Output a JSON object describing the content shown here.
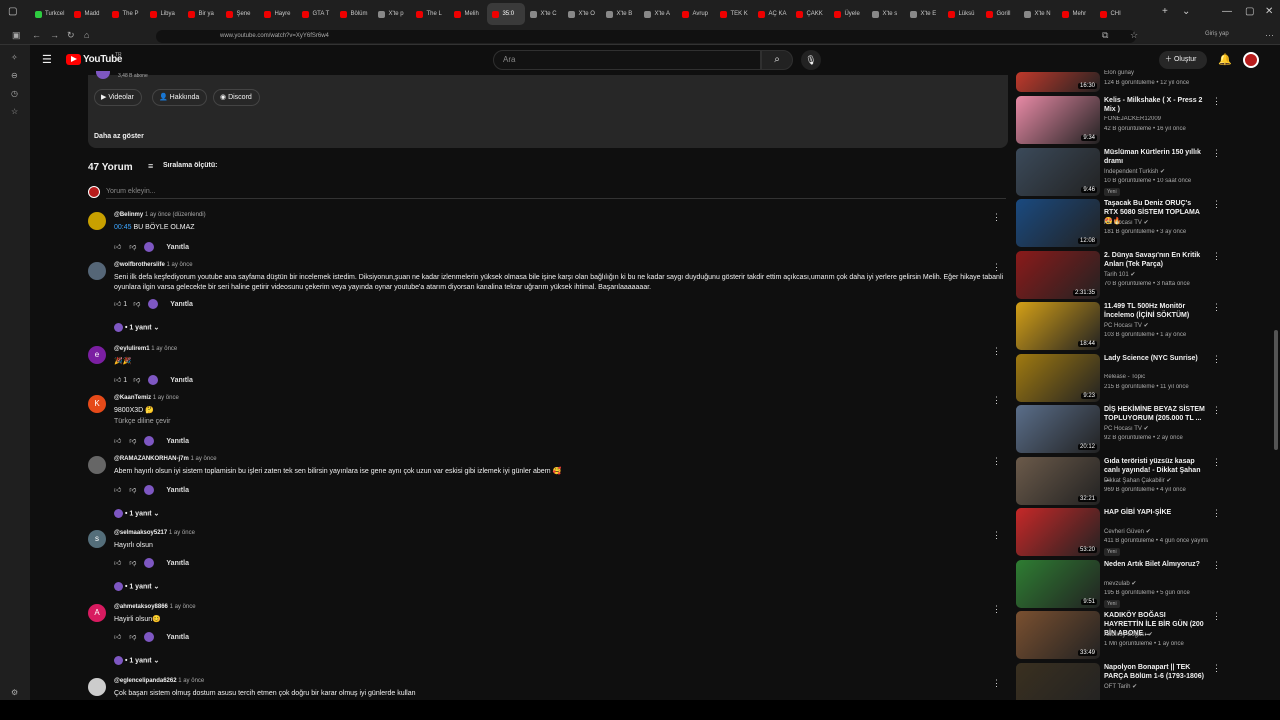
{
  "tabs": [
    {
      "label": "Turkcel",
      "color": "#2ecc40"
    },
    {
      "label": "Madd",
      "color": "#e00"
    },
    {
      "label": "The P",
      "color": "#e00"
    },
    {
      "label": "Libya",
      "color": "#e00"
    },
    {
      "label": "Bir ya",
      "color": "#e00"
    },
    {
      "label": "Şene",
      "color": "#e00"
    },
    {
      "label": "Hayre",
      "color": "#e00"
    },
    {
      "label": "GTA T",
      "color": "#e00"
    },
    {
      "label": "Bölüm",
      "color": "#e00"
    },
    {
      "label": "X'te p",
      "color": "#888"
    },
    {
      "label": "The L",
      "color": "#e00"
    },
    {
      "label": "Melih",
      "color": "#e00"
    },
    {
      "label": "35:0",
      "color": "#e00",
      "active": true
    },
    {
      "label": "X'te C",
      "color": "#888"
    },
    {
      "label": "X'te O",
      "color": "#888"
    },
    {
      "label": "X'te B",
      "color": "#888"
    },
    {
      "label": "X'te A",
      "color": "#888"
    },
    {
      "label": "Avrup",
      "color": "#e00"
    },
    {
      "label": "TEK K",
      "color": "#e00"
    },
    {
      "label": "AÇ KA",
      "color": "#e00"
    },
    {
      "label": "ÇAKK",
      "color": "#e00"
    },
    {
      "label": "Üyele",
      "color": "#e00"
    },
    {
      "label": "X'te s",
      "color": "#888"
    },
    {
      "label": "X'te E",
      "color": "#888"
    },
    {
      "label": "Lüksü",
      "color": "#e00"
    },
    {
      "label": "Gorill",
      "color": "#e00"
    },
    {
      "label": "X'te N",
      "color": "#888"
    },
    {
      "label": "Mehr",
      "color": "#e00"
    },
    {
      "label": "CHI",
      "color": "#e00"
    }
  ],
  "browser": {
    "url": "www.youtube.com/watch?v=XyY6fSr6w4",
    "signin": "Giriş yap"
  },
  "yt": {
    "logo": "YouTube",
    "region": "TR",
    "search_placeholder": "Ara",
    "create": "Oluştur"
  },
  "channel": {
    "subs": "3,48 B abone",
    "links": [
      "Videolar",
      "Hakkında",
      "Discord"
    ],
    "show_less": "Daha az göster"
  },
  "comments_header": {
    "count": "47 Yorum",
    "sort": "Sıralama ölçütü:",
    "add_placeholder": "Yorum ekleyin..."
  },
  "reply_label": "Yanıtla",
  "comments": [
    {
      "user": "@Belinmy",
      "time": "1 ay önce (düzenlendi)",
      "ts": "00:45",
      "text": " BU BÖYLE OLMAZ",
      "likes": "",
      "avatar": "#c8a000",
      "initial": "",
      "replies": ""
    },
    {
      "user": "@wolfbrotherslife",
      "time": "1 ay önce",
      "ts": "",
      "text": "Seni ilk defa keşfediyorum youtube ana sayfama düştün bir incelemek istedim. Diksiyonun,şuan ne kadar izlenmelerin yüksek olmasa bile işine karşı olan bağlılığın ki bu ne kadar saygı duyduğunu gösterir takdir ettim açıkcası,umarım çok daha iyi yerlere gelirsin Melih. Eğer hikaye tabanli oyunlara ilgin varsa gelecekte bir seri haline getirir videosunu çekerim veya yayında oynar youtube'a atarım diyorsan kanalina tekrar uğrarım yüksek ihtimal. Başarılaaaaaaar.",
      "likes": "1",
      "avatar": "#556677",
      "initial": "",
      "replies": "1 yanıt"
    },
    {
      "user": "@eylulirem1",
      "time": "1 ay önce",
      "ts": "",
      "text": "🎉🎉",
      "likes": "1",
      "avatar": "#7b1fa2",
      "initial": "e",
      "replies": ""
    },
    {
      "user": "@KaanTemiz",
      "time": "1 ay önce",
      "ts": "",
      "text": "9800X3D 🤔",
      "extra": "Türkçe diline çevir",
      "likes": "",
      "avatar": "#e64a19",
      "initial": "K",
      "replies": ""
    },
    {
      "user": "@RAMAZANKORHAN-j7m",
      "time": "1 ay önce",
      "ts": "",
      "text": "Abem hayırlı olsun iyi sistem toplamisin bu işleri zaten tek sen bilirsin yayınlara ise gene aynı çok uzun var eskisi gibi izlemek iyi günler abem 🥰",
      "likes": "",
      "avatar": "#666",
      "initial": "",
      "replies": "1 yanıt"
    },
    {
      "user": "@selmaaksoy5217",
      "time": "1 ay önce",
      "ts": "",
      "text": "Hayırlı olsun",
      "likes": "",
      "avatar": "#546e7a",
      "initial": "s",
      "replies": "1 yanıt"
    },
    {
      "user": "@ahmetaksoy8866",
      "time": "1 ay önce",
      "ts": "",
      "text": "Hayirli olsun😊",
      "likes": "",
      "avatar": "#d81b60",
      "initial": "A",
      "replies": "1 yanıt"
    },
    {
      "user": "@eglencelipanda6262",
      "time": "1 ay önce",
      "ts": "",
      "text": "Çok başarı sistem olmuş dostum asusu tercih etmen çok doğru bir karar olmuş iyi günlerde kullan",
      "likes": "",
      "avatar": "#ccc",
      "initial": "",
      "replies": ""
    }
  ],
  "sidebar": [
    {
      "title": "",
      "channel": "Elon gunay",
      "stats": "124 B görüntüleme • 12 yıl önce",
      "dur": "16:30",
      "color": "#c0392b",
      "verified": false,
      "badge": ""
    },
    {
      "title": "Kelis - Milkshake ( X - Press 2 Mix )",
      "channel": "FONEJACKER12009",
      "stats": "42 B görüntüleme • 16 yıl önce",
      "dur": "9:34",
      "color": "#e88aa6",
      "verified": false,
      "badge": ""
    },
    {
      "title": "Müslüman Kürtlerin 150 yıllık dramı",
      "channel": "Independent Turkish",
      "stats": "10 B görüntüleme • 10 saat önce",
      "dur": "9:46",
      "color": "#3b4a5a",
      "verified": true,
      "badge": "Yeni"
    },
    {
      "title": "Taşacak Bu Deniz ORUÇ's RTX 5080 SİSTEM TOPLAMA 😍🔥",
      "channel": "PC Hocası TV",
      "stats": "181 B görüntüleme • 3 ay önce",
      "dur": "12:08",
      "color": "#1a4a80",
      "verified": true,
      "badge": ""
    },
    {
      "title": "2. Dünya Savaşı'nın En Kritik Anları (Tek Parça)",
      "channel": "Tarih 101",
      "stats": "70 B görüntüleme • 3 hafta önce",
      "dur": "2:31:35",
      "color": "#8b1a1a",
      "verified": true,
      "badge": ""
    },
    {
      "title": "11.499 TL 500Hz Monitör İncelemo (İÇİNİ SÖKTÜM)",
      "channel": "PC Hocası TV",
      "stats": "103 B görüntüleme • 1 ay önce",
      "dur": "18:44",
      "color": "#d4a017",
      "verified": true,
      "badge": ""
    },
    {
      "title": "Lady Science (NYC Sunrise)",
      "channel": "Release - Topic",
      "stats": "215 B görüntüleme • 11 yıl önce",
      "dur": "9:23",
      "color": "#a07a10",
      "verified": false,
      "badge": ""
    },
    {
      "title": "DİŞ HEKİMİNE BEYAZ SİSTEM TOPLUYORUM (205.000 TL ...",
      "channel": "PC Hocası TV",
      "stats": "92 B görüntüleme • 2 ay önce",
      "dur": "20:12",
      "color": "#5a6e8a",
      "verified": true,
      "badge": ""
    },
    {
      "title": "Gıda teröristi yüzsüz kasap canlı yayında! - Dikkat Şahan ...",
      "channel": "Dikkat Şahan Çakabilir",
      "stats": "969 B görüntüleme • 4 yıl önce",
      "dur": "32:21",
      "color": "#6b5a4a",
      "verified": true,
      "badge": ""
    },
    {
      "title": "HAP GİBİ  YAPI-ŞİKE",
      "channel": "Cevheri Güven",
      "stats": "411 B görüntüleme • 4 gün önce yayınla...",
      "dur": "53:20",
      "color": "#c62828",
      "verified": true,
      "badge": "Yeni"
    },
    {
      "title": "Neden Artık Bilet Almıyoruz?",
      "channel": "mevzulab",
      "stats": "195 B görüntüleme • 5 gün önce",
      "dur": "9:51",
      "color": "#2e7d32",
      "verified": true,
      "badge": "Yeni"
    },
    {
      "title": "KADIKÖY BOĞASI HAYRETTİN İLE BİR GÜN (200 BİN ABONE ...",
      "channel": "Kadıköy Boğası",
      "stats": "1 Mn görüntüleme • 1 ay önce",
      "dur": "33:49",
      "color": "#7a5030",
      "verified": true,
      "badge": ""
    },
    {
      "title": "Napolyon Bonapart || TEK PARÇA Bölüm 1-6 (1793-1806)",
      "channel": "OFT Tarih",
      "stats": "",
      "dur": "",
      "color": "#3a3020",
      "verified": true,
      "badge": ""
    }
  ]
}
